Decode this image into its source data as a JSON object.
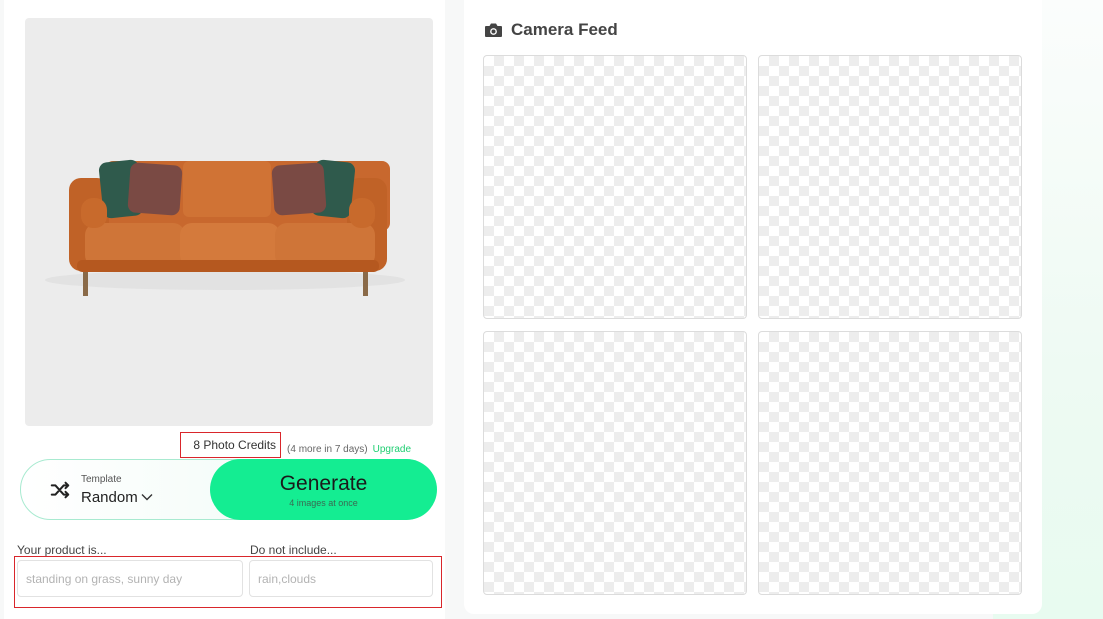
{
  "product": {
    "image_alt": "orange sofa product photo",
    "colors": {
      "sofa": "#c8682e",
      "pillow_green": "#2f5a4c",
      "pillow_mauve": "#7a4a44",
      "legs": "#8a6a48"
    }
  },
  "credits": {
    "count_label": "8 Photo Credits",
    "extra_label": "(4 more in 7 days)",
    "upgrade_label": "Upgrade"
  },
  "template": {
    "label": "Template",
    "value": "Random",
    "icon": "shuffle-icon"
  },
  "generate": {
    "title": "Generate",
    "subtitle": "4 images at once"
  },
  "prompt": {
    "product_label": "Your product is...",
    "product_placeholder": "standing on grass, sunny day",
    "product_value": "",
    "exclude_label": "Do not include...",
    "exclude_placeholder": "rain,clouds",
    "exclude_value": ""
  },
  "feed": {
    "title": "Camera Feed",
    "icon": "camera-icon",
    "tiles": [
      "",
      "",
      "",
      ""
    ]
  },
  "colors": {
    "accent": "#14ed92",
    "link": "#1fce72",
    "highlight": "#d9262b"
  }
}
